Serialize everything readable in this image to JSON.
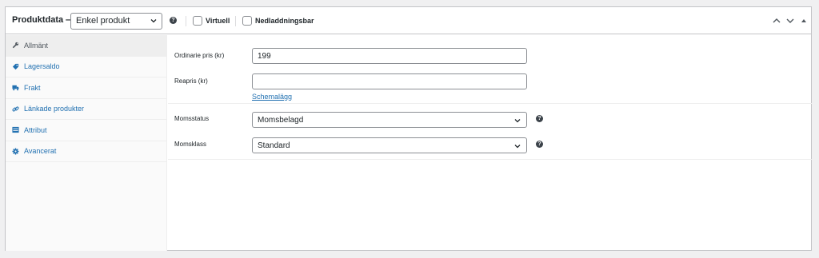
{
  "header": {
    "title": "Produktdata —",
    "product_type": "Enkel produkt",
    "virtual_label": "Virtuell",
    "downloadable_label": "Nedladdningsbar",
    "help_glyph": "?"
  },
  "sidebar": {
    "items": [
      {
        "label": "Allmänt",
        "icon": "wrench-icon",
        "active": true
      },
      {
        "label": "Lagersaldo",
        "icon": "tag-icon",
        "active": false
      },
      {
        "label": "Frakt",
        "icon": "truck-icon",
        "active": false
      },
      {
        "label": "Länkade produkter",
        "icon": "link-icon",
        "active": false
      },
      {
        "label": "Attribut",
        "icon": "list-icon",
        "active": false
      },
      {
        "label": "Avancerat",
        "icon": "gear-icon",
        "active": false
      }
    ]
  },
  "general": {
    "regular_price_label": "Ordinarie pris (kr)",
    "regular_price_value": "199",
    "sale_price_label": "Reapris (kr)",
    "sale_price_value": "",
    "schedule_link": "Schemalägg",
    "tax_status_label": "Momsstatus",
    "tax_status_value": "Momsbelagd",
    "tax_class_label": "Momsklass",
    "tax_class_value": "Standard"
  },
  "colors": {
    "link": "#2271b1",
    "border": "#c3c4c7",
    "background": "#f0f0f1"
  }
}
